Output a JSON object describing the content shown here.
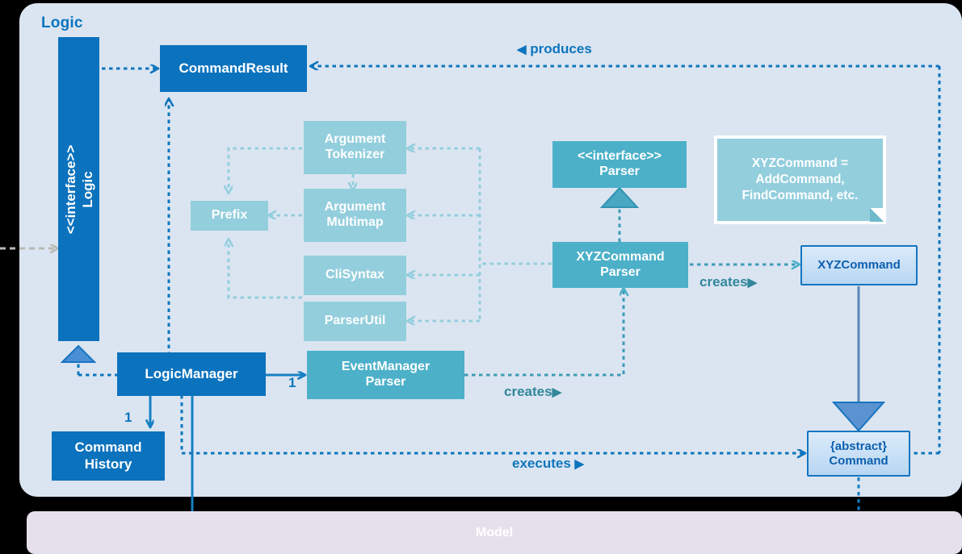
{
  "diagram": {
    "title": "Logic",
    "panel_color": "#dbe5f1",
    "accent_dark_blue": "#0b72bd",
    "accent_teal": "#4cb0c9",
    "accent_light_blue": "#93cedd",
    "model_bar_color": "#e6e0ec"
  },
  "nodes": {
    "logic_interface": {
      "stereotype": "<<interface>>",
      "name": "Logic"
    },
    "command_result": {
      "name": "CommandResult"
    },
    "argument_tokenizer": {
      "line1": "Argument",
      "line2": "Tokenizer"
    },
    "argument_multimap": {
      "line1": "Argument",
      "line2": "Multimap"
    },
    "prefix": {
      "name": "Prefix"
    },
    "cli_syntax": {
      "name": "CliSyntax"
    },
    "parser_util": {
      "name": "ParserUtil"
    },
    "parser_interface": {
      "stereotype": "<<interface>>",
      "name": "Parser"
    },
    "xyz_command_parser": {
      "line1": "XYZCommand",
      "line2": "Parser"
    },
    "xyz_command": {
      "name": "XYZCommand"
    },
    "logic_manager": {
      "name": "LogicManager"
    },
    "event_manager_parser": {
      "line1": "EventManager",
      "line2": "Parser"
    },
    "command_history": {
      "line1": "Command",
      "line2": "History"
    },
    "abstract_command": {
      "line1": "{abstract}",
      "line2": "Command"
    },
    "model": {
      "name": "Model"
    }
  },
  "note": {
    "line1": "XYZCommand =",
    "line2": "AddCommand,",
    "line3": "FindCommand, etc."
  },
  "edge_labels": {
    "produces": "produces",
    "creates_parser": "creates",
    "creates_event": "creates",
    "executes": "executes"
  },
  "multiplicities": {
    "logic_manager_to_event_parser": "1",
    "logic_manager_to_command_history": "1"
  }
}
